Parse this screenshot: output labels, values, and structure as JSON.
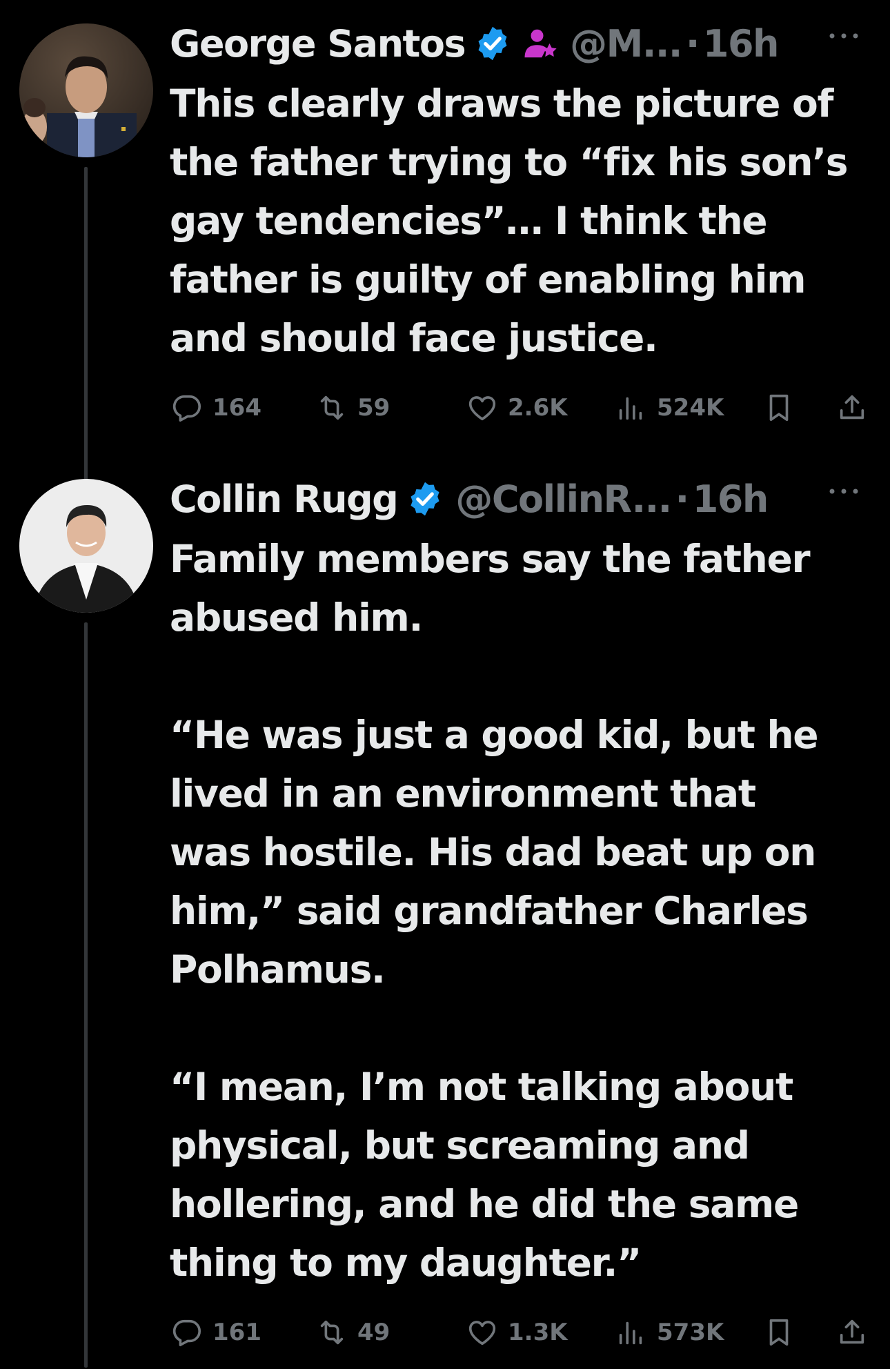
{
  "tweets": [
    {
      "author_name": "George Santos",
      "handle": "@M...",
      "separator": "·",
      "time": "16h",
      "text": "This clearly draws the picture of\nthe father trying to “fix his son’s\ngay tendencies”… I think the\nfather is guilty of enabling him\nand should face justice.",
      "replies": "164",
      "reposts": "59",
      "likes": "2.6K",
      "views": "524K",
      "badges": [
        "verified-badge-icon",
        "affiliate-badge-icon"
      ]
    },
    {
      "author_name": "Collin Rugg",
      "handle": "@CollinR...",
      "separator": "·",
      "time": "16h",
      "text": "Family members say the father\nabused him.\n\n“He was just a good kid, but he\nlived in an environment that\nwas hostile. His dad beat up on\nhim,” said grandfather Charles\nPolhamus.\n\n“I mean, I’m not talking about\nphysical, but screaming and\nhollering, and he did the same\nthing to my daughter.”",
      "replies": "161",
      "reposts": "49",
      "likes": "1.3K",
      "views": "573K",
      "badges": [
        "verified-badge-icon"
      ]
    }
  ],
  "colors": {
    "background": "#000000",
    "text_primary": "#e7e9ea",
    "text_secondary": "#71767b",
    "verified_blue": "#1d9bf0",
    "affiliate_purple": "#c936cc",
    "thread_line": "#333639"
  },
  "icons": {
    "reply": "reply-icon",
    "repost": "repost-icon",
    "like": "like-icon",
    "views": "views-icon",
    "bookmark": "bookmark-icon",
    "share": "share-icon",
    "more": "more-icon"
  }
}
